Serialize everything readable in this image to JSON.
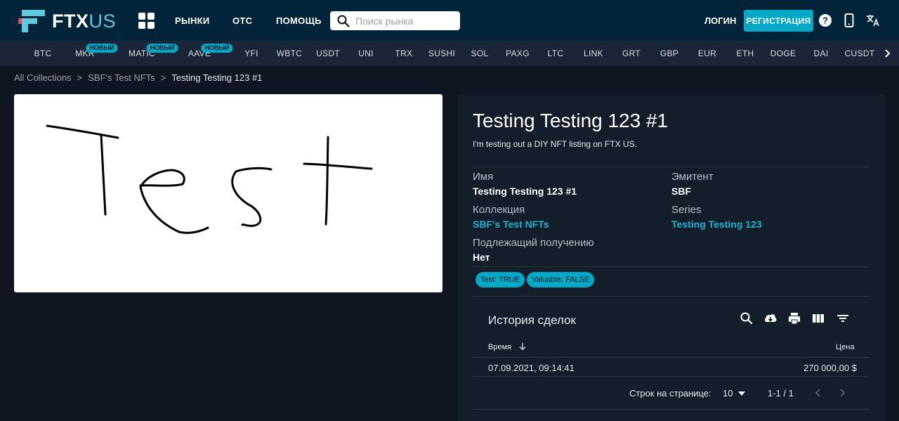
{
  "brand": {
    "name": "FTX",
    "suffix": "US"
  },
  "nav": {
    "markets": "РЫНКИ",
    "otc": "OTC",
    "help": "ПОМОЩЬ",
    "search_placeholder": "Поиск рынка",
    "login": "ЛОГИН",
    "register": "РЕГИСТРАЦИЯ"
  },
  "ticker": {
    "items": [
      "BTC",
      "MKR",
      "MATIC",
      "AAVE",
      "YFI",
      "WBTC",
      "USDT",
      "UNI",
      "TRX",
      "SUSHI",
      "SOL",
      "PAXG",
      "LTC",
      "LINK",
      "GRT",
      "GBP",
      "EUR",
      "ETH",
      "DOGE",
      "DAI",
      "CUSDT"
    ],
    "new_badge": "НОВЫЙ"
  },
  "breadcrumb": {
    "root": "All Collections",
    "sep": ">",
    "collection": "SBF's Test NFTs",
    "current": "Testing Testing 123 #1"
  },
  "nft": {
    "title": "Testing Testing 123 #1",
    "description": "I'm testing out a DIY NFT listing on FTX US.",
    "fields": {
      "name_label": "Имя",
      "name_value": "Testing Testing 123 #1",
      "issuer_label": "Эмитент",
      "issuer_value": "SBF",
      "collection_label": "Коллекция",
      "collection_value": "SBF's Test NFTs",
      "series_label": "Series",
      "series_value": "Testing Testing 123",
      "redeemable_label": "Подлежащий получению",
      "redeemable_value": "Нет"
    },
    "attributes": [
      "Test: TRUE",
      "Valuable: FALSE"
    ]
  },
  "history": {
    "title": "История сделок",
    "col_time": "Время",
    "col_price": "Цена",
    "rows": [
      {
        "time": "07.09.2021, 09:14:41",
        "price": "270 000,00 $"
      }
    ],
    "rows_per_page_label": "Строк на странице:",
    "rows_per_page": "10",
    "range": "1-1 / 1"
  },
  "colors": {
    "accent": "#02a9c7",
    "link": "#17b3d3",
    "topbar": "#02243a",
    "background": "#0f1621"
  },
  "icons": [
    "grid-icon",
    "search-icon",
    "help-icon",
    "phone-icon",
    "translate-icon",
    "chevron-right-icon",
    "download-icon",
    "print-icon",
    "columns-icon",
    "filter-icon",
    "sort-down-icon",
    "caret-down-icon",
    "chevron-left-icon"
  ]
}
